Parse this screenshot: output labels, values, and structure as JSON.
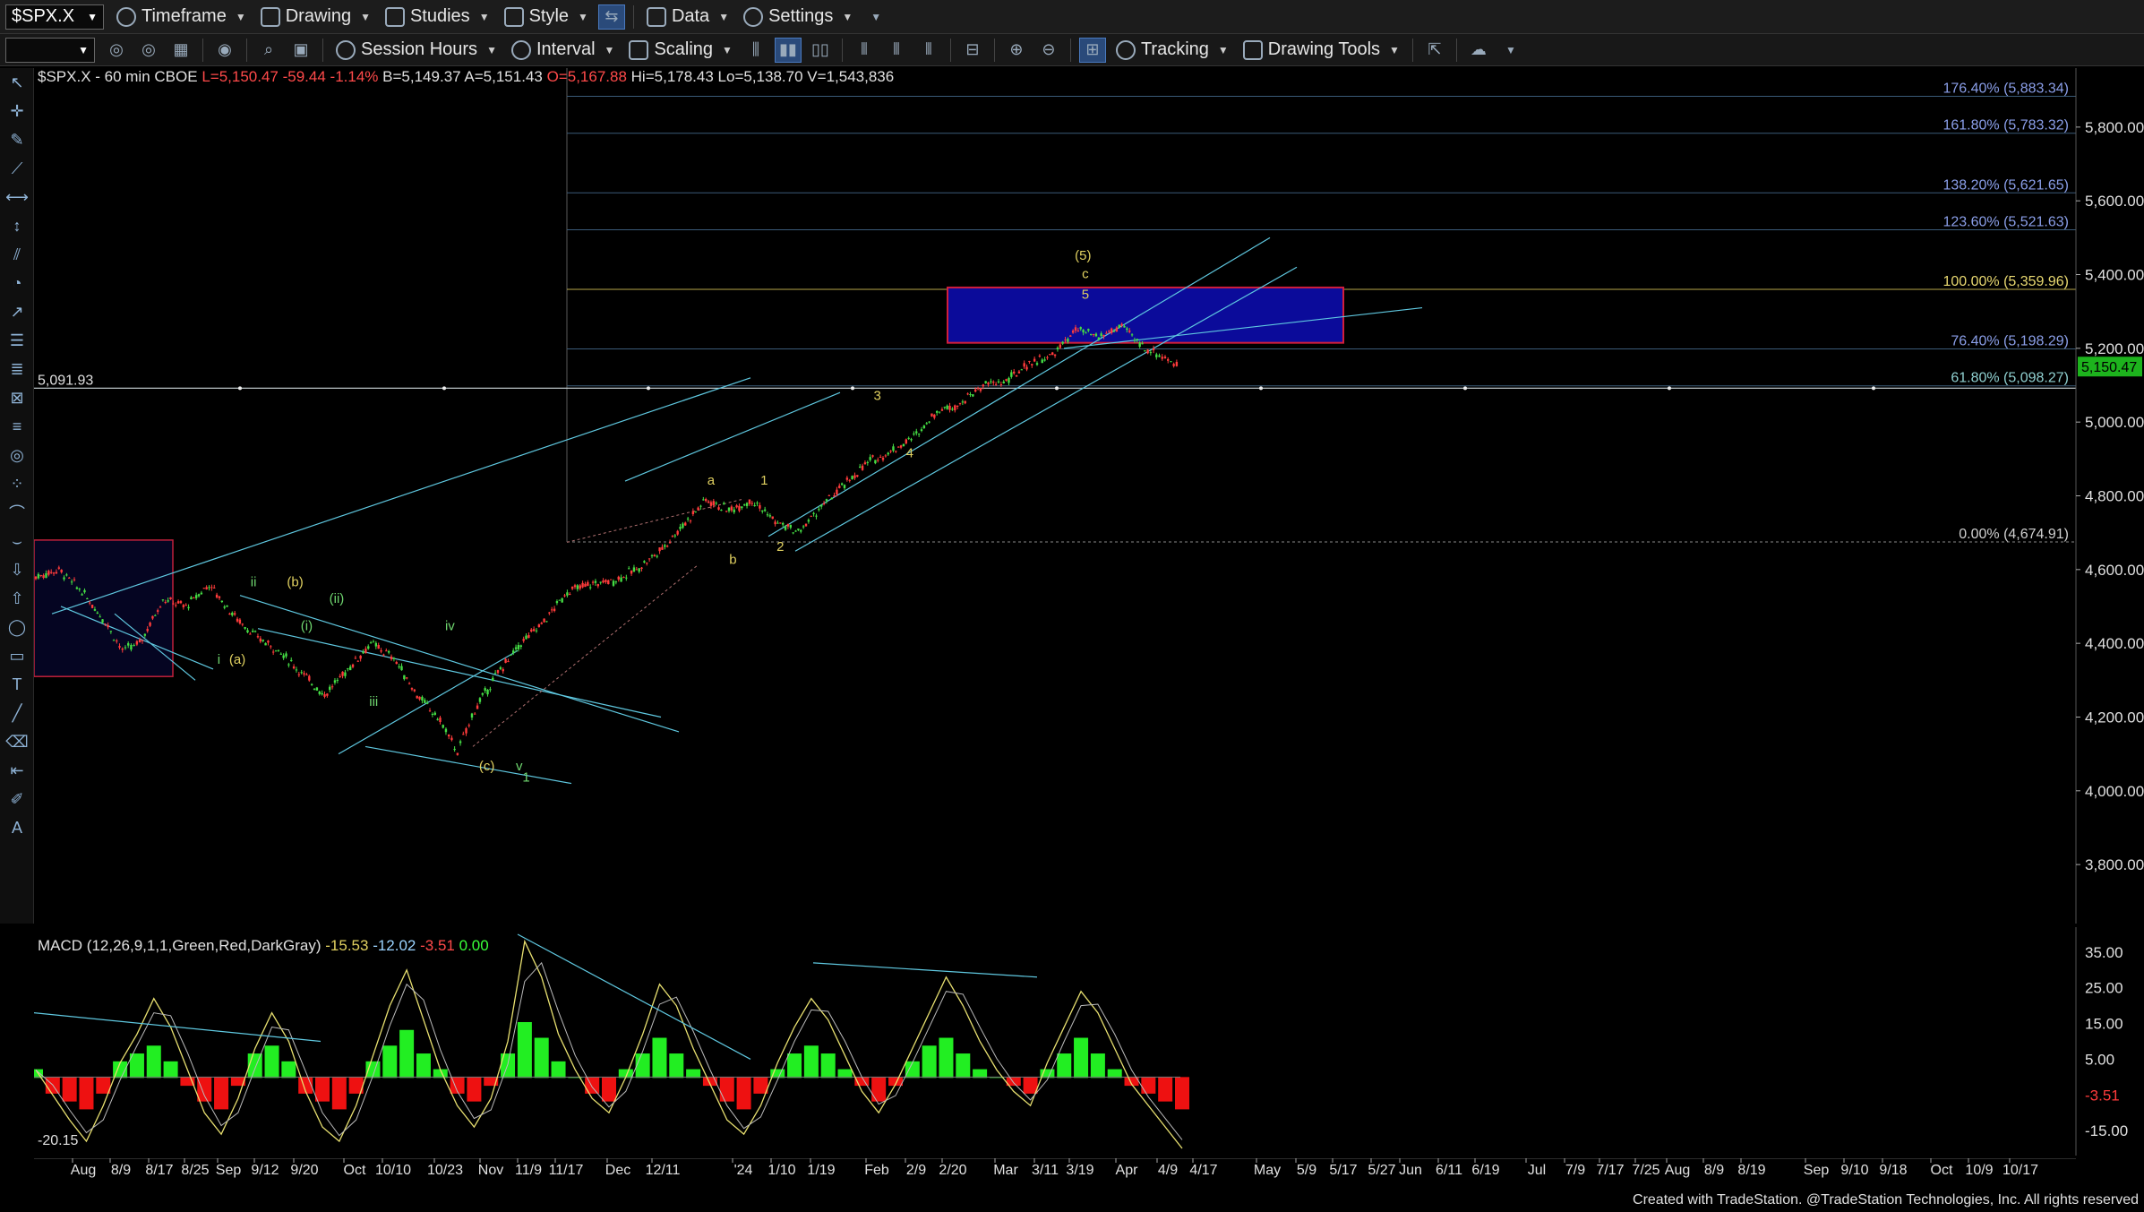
{
  "toolbar1": {
    "symbol": "$SPX.X",
    "timeframe": "Timeframe",
    "drawing": "Drawing",
    "studies": "Studies",
    "style": "Style",
    "data": "Data",
    "settings": "Settings"
  },
  "toolbar2": {
    "session_hours": "Session Hours",
    "interval": "Interval",
    "scaling": "Scaling",
    "tracking": "Tracking",
    "drawing_tools": "Drawing Tools"
  },
  "price_header": {
    "title": "$SPX.X - 60 min  CBOE",
    "last": "L=5,150.47",
    "change": "-59.44",
    "pct": "-1.14%",
    "bid": "B=5,149.37",
    "ask": "A=5,151.43",
    "open": "O=5,167.88",
    "high": "Hi=5,178.43",
    "low": "Lo=5,138.70",
    "volume": "V=1,543,836"
  },
  "macd_header": {
    "label": "MACD (12,26,9,1,1,Green,Red,DarkGray)",
    "v1": "-15.53",
    "v2": "-12.02",
    "v3": "-3.51",
    "v4": "0.00"
  },
  "colors": {
    "bg": "#000000",
    "fib_line": "#3a5a78",
    "target_box_fill": "#0b0b9a",
    "target_box_border": "#d21e3c",
    "wave_yellow": "#e0d060",
    "wave_green": "#6fd66f",
    "channel": "#5fc8e0",
    "price_up": "#44dd44",
    "price_down": "#ff3b3b",
    "last_price_bg": "#1db31d"
  },
  "chart_data": {
    "type": "candlestick",
    "y_axis": {
      "min": 3640,
      "max": 5960,
      "ticks": [
        3800,
        4000,
        4200,
        4400,
        4600,
        4800,
        5000,
        5200,
        5400,
        5600,
        5800
      ],
      "tick_labels": [
        "3,800.00",
        "4,000.00",
        "4,200.00",
        "4,400.00",
        "4,600.00",
        "4,800.00",
        "5,000.00",
        "5,200.00",
        "5,400.00",
        "5,600.00",
        "5,800.00"
      ]
    },
    "x_axis_labels": [
      "Aug",
      "8/9",
      "8/17",
      "8/25",
      "Sep",
      "9/12",
      "9/20",
      "Oct",
      "10/10",
      "10/23",
      "Nov",
      "11/9",
      "11/17",
      "Dec",
      "12/11",
      "'24",
      "1/10",
      "1/19",
      "Feb",
      "2/9",
      "2/20",
      "Mar",
      "3/11",
      "3/19",
      "Apr",
      "4/9",
      "4/17",
      "May",
      "5/9",
      "5/17",
      "5/27",
      "Jun",
      "6/11",
      "6/19",
      "Jul",
      "7/9",
      "7/17",
      "7/25",
      "Aug",
      "8/9",
      "8/19",
      "Sep",
      "9/10",
      "9/18",
      "Oct",
      "10/9",
      "10/17"
    ],
    "last_price": 5150.47,
    "last_price_label": "5,150.47",
    "horizontal_line": {
      "value": 5091.93,
      "label": "5,091.93"
    },
    "fib_levels": [
      {
        "pct": "176.40%",
        "label": "176.40% (5,883.34)",
        "value": 5883.34
      },
      {
        "pct": "161.80%",
        "label": "161.80% (5,783.32)",
        "value": 5783.32
      },
      {
        "pct": "138.20%",
        "label": "138.20% (5,621.65)",
        "value": 5621.65
      },
      {
        "pct": "123.60%",
        "label": "123.60% (5,521.63)",
        "value": 5521.63
      },
      {
        "pct": "100.00%",
        "label": "100.00% (5,359.96)",
        "value": 5359.96
      },
      {
        "pct": "76.40%",
        "label": "76.40% (5,198.29)",
        "value": 5198.29
      },
      {
        "pct": "61.80%",
        "label": "61.80% (5,098.27)",
        "value": 5098.27
      },
      {
        "pct": "0.00%",
        "label": "0.00% (4,674.91)",
        "value": 4674.91
      }
    ],
    "target_box": {
      "low": 5215,
      "high": 5365
    },
    "red_box": {
      "low": 4310,
      "high": 4680
    },
    "price_path": [
      [
        0,
        4580
      ],
      [
        20,
        4600
      ],
      [
        40,
        4540
      ],
      [
        60,
        4460
      ],
      [
        75,
        4380
      ],
      [
        90,
        4400
      ],
      [
        110,
        4520
      ],
      [
        130,
        4500
      ],
      [
        150,
        4560
      ],
      [
        170,
        4480
      ],
      [
        190,
        4420
      ],
      [
        210,
        4380
      ],
      [
        230,
        4320
      ],
      [
        250,
        4260
      ],
      [
        270,
        4330
      ],
      [
        290,
        4400
      ],
      [
        310,
        4360
      ],
      [
        330,
        4260
      ],
      [
        350,
        4190
      ],
      [
        365,
        4105
      ],
      [
        380,
        4220
      ],
      [
        400,
        4320
      ],
      [
        420,
        4400
      ],
      [
        440,
        4460
      ],
      [
        460,
        4540
      ],
      [
        480,
        4560
      ],
      [
        500,
        4570
      ],
      [
        520,
        4600
      ],
      [
        540,
        4650
      ],
      [
        560,
        4720
      ],
      [
        580,
        4790
      ],
      [
        600,
        4760
      ],
      [
        620,
        4790
      ],
      [
        640,
        4730
      ],
      [
        660,
        4700
      ],
      [
        680,
        4770
      ],
      [
        700,
        4830
      ],
      [
        720,
        4890
      ],
      [
        740,
        4920
      ],
      [
        760,
        4960
      ],
      [
        780,
        5030
      ],
      [
        800,
        5050
      ],
      [
        820,
        5100
      ],
      [
        840,
        5110
      ],
      [
        860,
        5160
      ],
      [
        880,
        5180
      ],
      [
        900,
        5250
      ],
      [
        920,
        5230
      ],
      [
        940,
        5260
      ],
      [
        960,
        5200
      ],
      [
        975,
        5180
      ],
      [
        990,
        5145
      ]
    ],
    "wave_labels": [
      {
        "text": "(5)",
        "x": 908,
        "v": 5440,
        "color": "yellow"
      },
      {
        "text": "c",
        "x": 910,
        "v": 5390,
        "color": "yellow"
      },
      {
        "text": "5",
        "x": 910,
        "v": 5335,
        "color": "yellow"
      },
      {
        "text": "3",
        "x": 730,
        "v": 5060,
        "color": "yellow"
      },
      {
        "text": "4",
        "x": 758,
        "v": 4905,
        "color": "yellow"
      },
      {
        "text": "1",
        "x": 632,
        "v": 4830,
        "color": "yellow"
      },
      {
        "text": "2",
        "x": 646,
        "v": 4650,
        "color": "yellow"
      },
      {
        "text": "a",
        "x": 586,
        "v": 4830,
        "color": "yellow"
      },
      {
        "text": "b",
        "x": 605,
        "v": 4615,
        "color": "yellow"
      },
      {
        "text": "ii",
        "x": 190,
        "v": 4555,
        "color": "green"
      },
      {
        "text": "(b)",
        "x": 226,
        "v": 4555,
        "color": "yellow"
      },
      {
        "text": "(ii)",
        "x": 262,
        "v": 4510,
        "color": "green"
      },
      {
        "text": "(i)",
        "x": 236,
        "v": 4435,
        "color": "green"
      },
      {
        "text": "(a)",
        "x": 176,
        "v": 4345,
        "color": "yellow"
      },
      {
        "text": "i",
        "x": 160,
        "v": 4345,
        "color": "green"
      },
      {
        "text": "iv",
        "x": 360,
        "v": 4435,
        "color": "green"
      },
      {
        "text": "iii",
        "x": 294,
        "v": 4230,
        "color": "green"
      },
      {
        "text": "(c)",
        "x": 392,
        "v": 4055,
        "color": "yellow"
      },
      {
        "text": "v",
        "x": 420,
        "v": 4055,
        "color": "green"
      },
      {
        "text": "1",
        "x": 426,
        "v": 4025,
        "color": "green"
      }
    ],
    "macd": {
      "y_ticks": [
        35,
        25,
        15,
        5,
        -5,
        -15
      ],
      "y_tick_labels": [
        "35.00",
        "25.00",
        "15.00",
        "5.00",
        "-3.51",
        "-15.00"
      ],
      "min_label": "-20.15",
      "macd_values": [
        2,
        -5,
        -12,
        -18,
        -8,
        4,
        12,
        22,
        14,
        2,
        -10,
        -16,
        -6,
        8,
        18,
        10,
        -4,
        -14,
        -18,
        -8,
        6,
        20,
        30,
        16,
        2,
        -8,
        -14,
        -6,
        10,
        38,
        28,
        12,
        2,
        -6,
        -10,
        0,
        12,
        26,
        20,
        8,
        -2,
        -12,
        -16,
        -8,
        4,
        14,
        22,
        16,
        6,
        -4,
        -10,
        -2,
        8,
        18,
        28,
        20,
        10,
        2,
        -4,
        -8,
        4,
        14,
        24,
        18,
        8,
        -2,
        -8,
        -14,
        -20
      ],
      "hist_values": [
        1,
        -2,
        -3,
        -4,
        -2,
        2,
        3,
        4,
        2,
        -1,
        -3,
        -4,
        -1,
        3,
        4,
        2,
        -2,
        -3,
        -4,
        -2,
        2,
        4,
        6,
        3,
        1,
        -2,
        -3,
        -1,
        3,
        7,
        5,
        2,
        0,
        -2,
        -3,
        1,
        3,
        5,
        3,
        1,
        -1,
        -3,
        -4,
        -2,
        1,
        3,
        4,
        3,
        1,
        -1,
        -3,
        -1,
        2,
        4,
        5,
        3,
        1,
        0,
        -1,
        -2,
        1,
        3,
        5,
        3,
        1,
        -1,
        -2,
        -3,
        -4
      ]
    }
  },
  "footer": "Created with TradeStation. @TradeStation Technologies, Inc. All rights reserved"
}
